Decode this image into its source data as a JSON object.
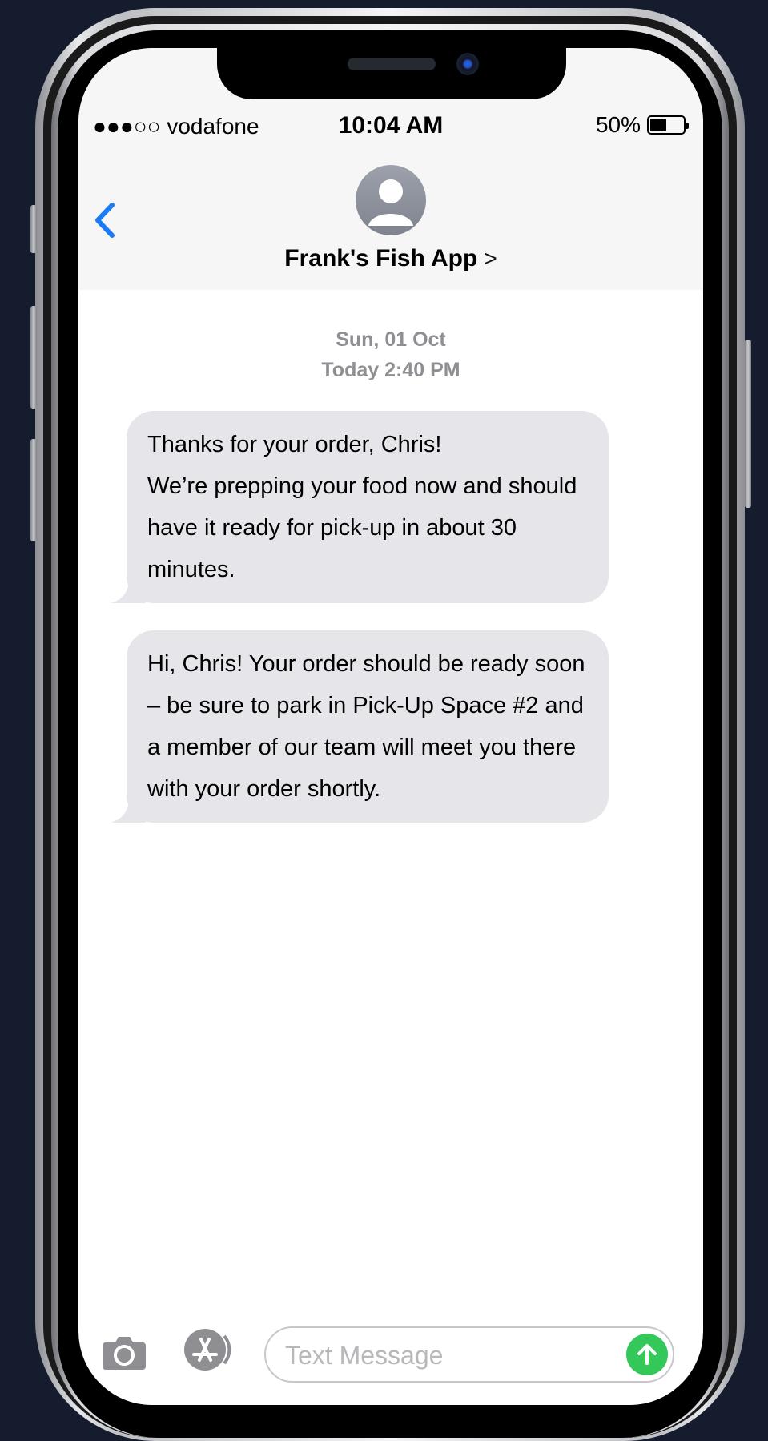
{
  "status_bar": {
    "carrier": "●●●○○ vodafone",
    "time": "10:04 AM",
    "battery": "50%"
  },
  "contact": {
    "name": "Frank's Fish App",
    "chevron": ">"
  },
  "conversation": {
    "date_line": "Sun, 01 Oct",
    "time_line": "Today 2:40 PM",
    "messages": [
      {
        "text": "Thanks for your order, Chris!\nWe’re prepping your food now and should have it ready for pick-up in about 30 minutes."
      },
      {
        "text": "Hi, Chris! Your order should be ready soon – be sure to park in Pick-Up Space #2 and a member of our team will meet you there with your order shortly."
      }
    ]
  },
  "composer": {
    "placeholder": "Text Message"
  },
  "colors": {
    "accent": "#1b7af5",
    "bubble": "#e5e5ea",
    "send": "#34c759",
    "background": "#141c2d"
  },
  "icons": [
    "back-chevron-icon",
    "contact-avatar-icon",
    "camera-icon",
    "app-store-icon",
    "send-arrow-icon",
    "battery-icon"
  ]
}
